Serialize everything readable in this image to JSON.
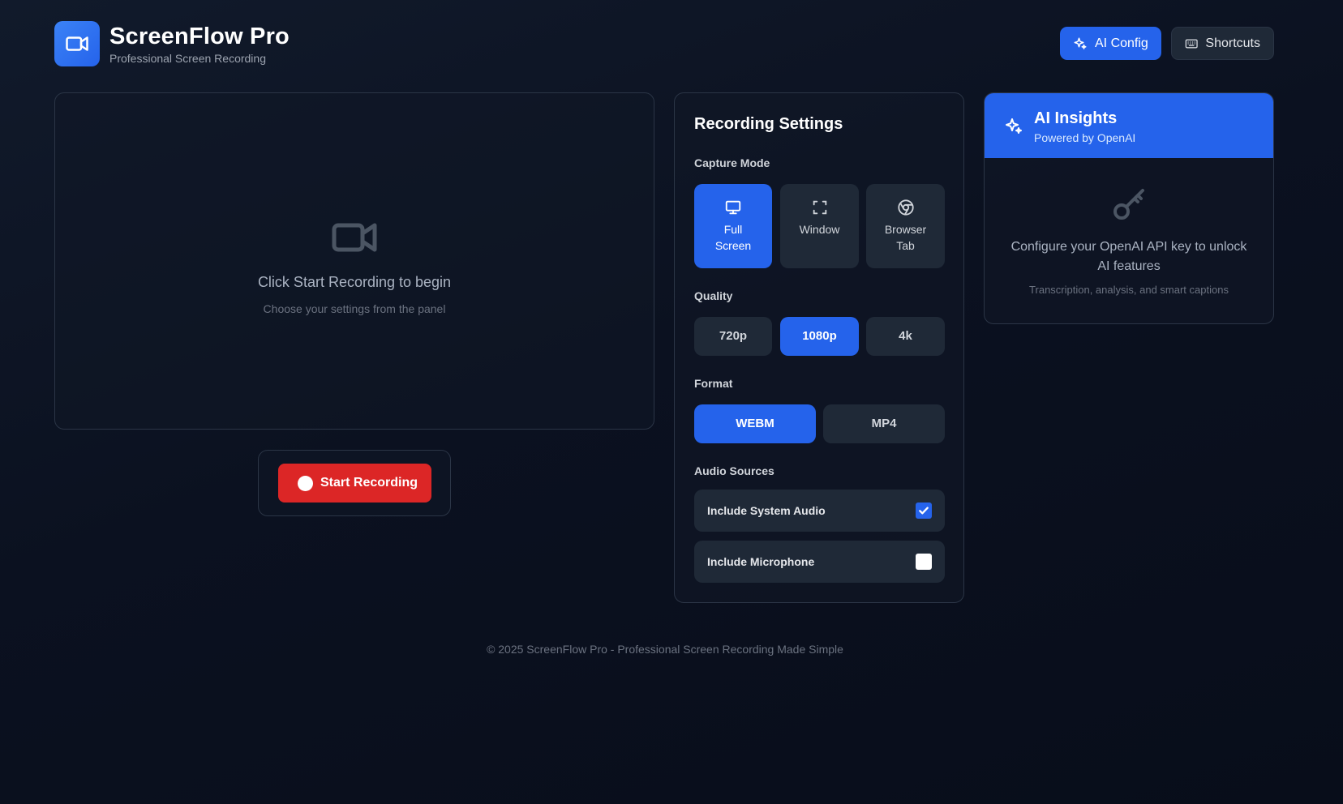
{
  "header": {
    "app_title": "ScreenFlow Pro",
    "app_subtitle": "Professional Screen Recording",
    "logo_icon": "video-camera-icon",
    "ai_config_label": "AI Config",
    "shortcuts_label": "Shortcuts"
  },
  "preview": {
    "icon": "video-camera-icon",
    "title": "Click Start Recording to begin",
    "hint": "Choose your settings from the panel",
    "start_label": "Start Recording"
  },
  "settings": {
    "title": "Recording Settings",
    "capture_mode": {
      "label": "Capture Mode",
      "options": [
        {
          "label_line1": "Full",
          "label_line2": "Screen",
          "icon": "monitor-icon",
          "selected": true
        },
        {
          "label_line1": "Window",
          "label_line2": "",
          "icon": "fullscreen-frame-icon",
          "selected": false
        },
        {
          "label_line1": "Browser",
          "label_line2": "Tab",
          "icon": "chrome-icon",
          "selected": false
        }
      ]
    },
    "quality": {
      "label": "Quality",
      "options": [
        {
          "label": "720p",
          "selected": false
        },
        {
          "label": "1080p",
          "selected": true
        },
        {
          "label": "4k",
          "selected": false
        }
      ]
    },
    "format": {
      "label": "Format",
      "options": [
        {
          "label": "WEBM",
          "selected": true
        },
        {
          "label": "MP4",
          "selected": false
        }
      ]
    },
    "audio": {
      "label": "Audio Sources",
      "options": [
        {
          "label": "Include System Audio",
          "checked": true
        },
        {
          "label": "Include Microphone",
          "checked": false
        }
      ]
    }
  },
  "ai_insights": {
    "title": "AI Insights",
    "subtitle": "Powered by OpenAI",
    "icon": "sparkles-icon",
    "empty_icon": "key-icon",
    "message": "Configure your OpenAI API key to unlock AI features",
    "note": "Transcription, analysis, and smart captions"
  },
  "footer": {
    "text": "© 2025 ScreenFlow Pro - Professional Screen Recording Made Simple"
  },
  "colors": {
    "accent": "#2563eb",
    "record": "#dc2626",
    "background": "#0b1120",
    "panel": "#1f2937"
  }
}
